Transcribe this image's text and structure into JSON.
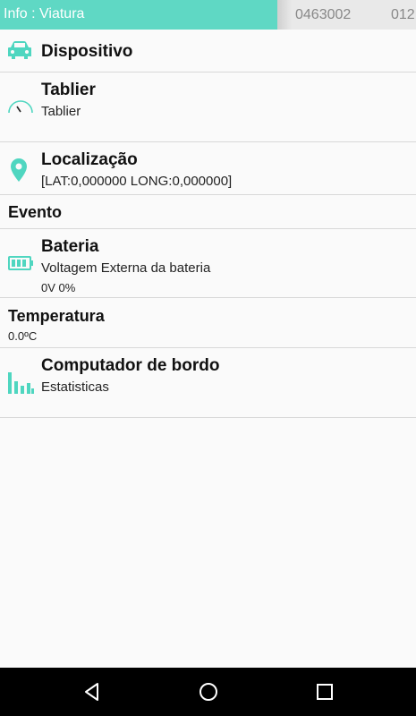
{
  "tabs": {
    "active": "Info : Viatura",
    "second": "0463002",
    "third": "012"
  },
  "rows": {
    "dispositivo": {
      "title": "Dispositivo"
    },
    "tablier": {
      "title": "Tablier",
      "subtitle": "Tablier"
    },
    "localizacao": {
      "title": "Localização",
      "subtitle": "[LAT:0,000000 LONG:0,000000]"
    },
    "evento": {
      "title": "Evento"
    },
    "bateria": {
      "title": "Bateria",
      "subtitle": "Voltagem Externa da bateria",
      "detail": "0V 0%"
    },
    "temperatura": {
      "title": "Temperatura",
      "value": "0.0ºC"
    },
    "computador": {
      "title": "Computador de bordo",
      "subtitle": "Estatisticas"
    }
  },
  "icons": {
    "dispositivo": "car-icon",
    "tablier": "speedometer-icon",
    "localizacao": "location-pin-icon",
    "bateria": "battery-icon",
    "computador": "bar-chart-icon"
  },
  "colors": {
    "accent": "#5fd8c4",
    "icon": "#4fd6c0",
    "navbar": "#000000"
  }
}
